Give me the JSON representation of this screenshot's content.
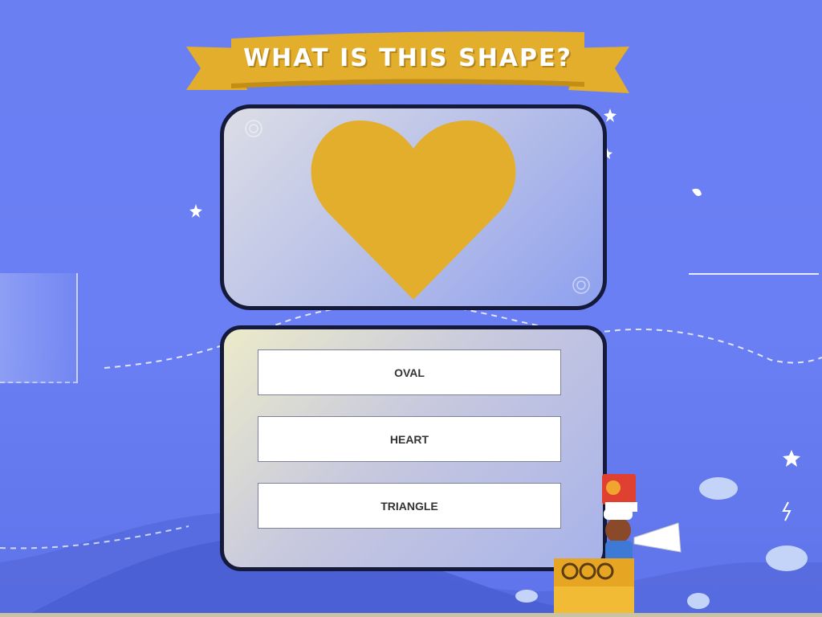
{
  "question": {
    "title": "WHAT IS THIS SHAPE?"
  },
  "shape": {
    "name": "heart",
    "color": "#e3ae2b"
  },
  "answers": [
    {
      "label": "OVAL"
    },
    {
      "label": "HEART"
    },
    {
      "label": "TRIANGLE"
    }
  ],
  "colors": {
    "background": "#6a7ff2",
    "banner": "#e3ae2b",
    "card_border": "#151a3a"
  },
  "icons": [
    "star-icon",
    "cloud-icon",
    "character-icon",
    "megaphone-icon"
  ]
}
